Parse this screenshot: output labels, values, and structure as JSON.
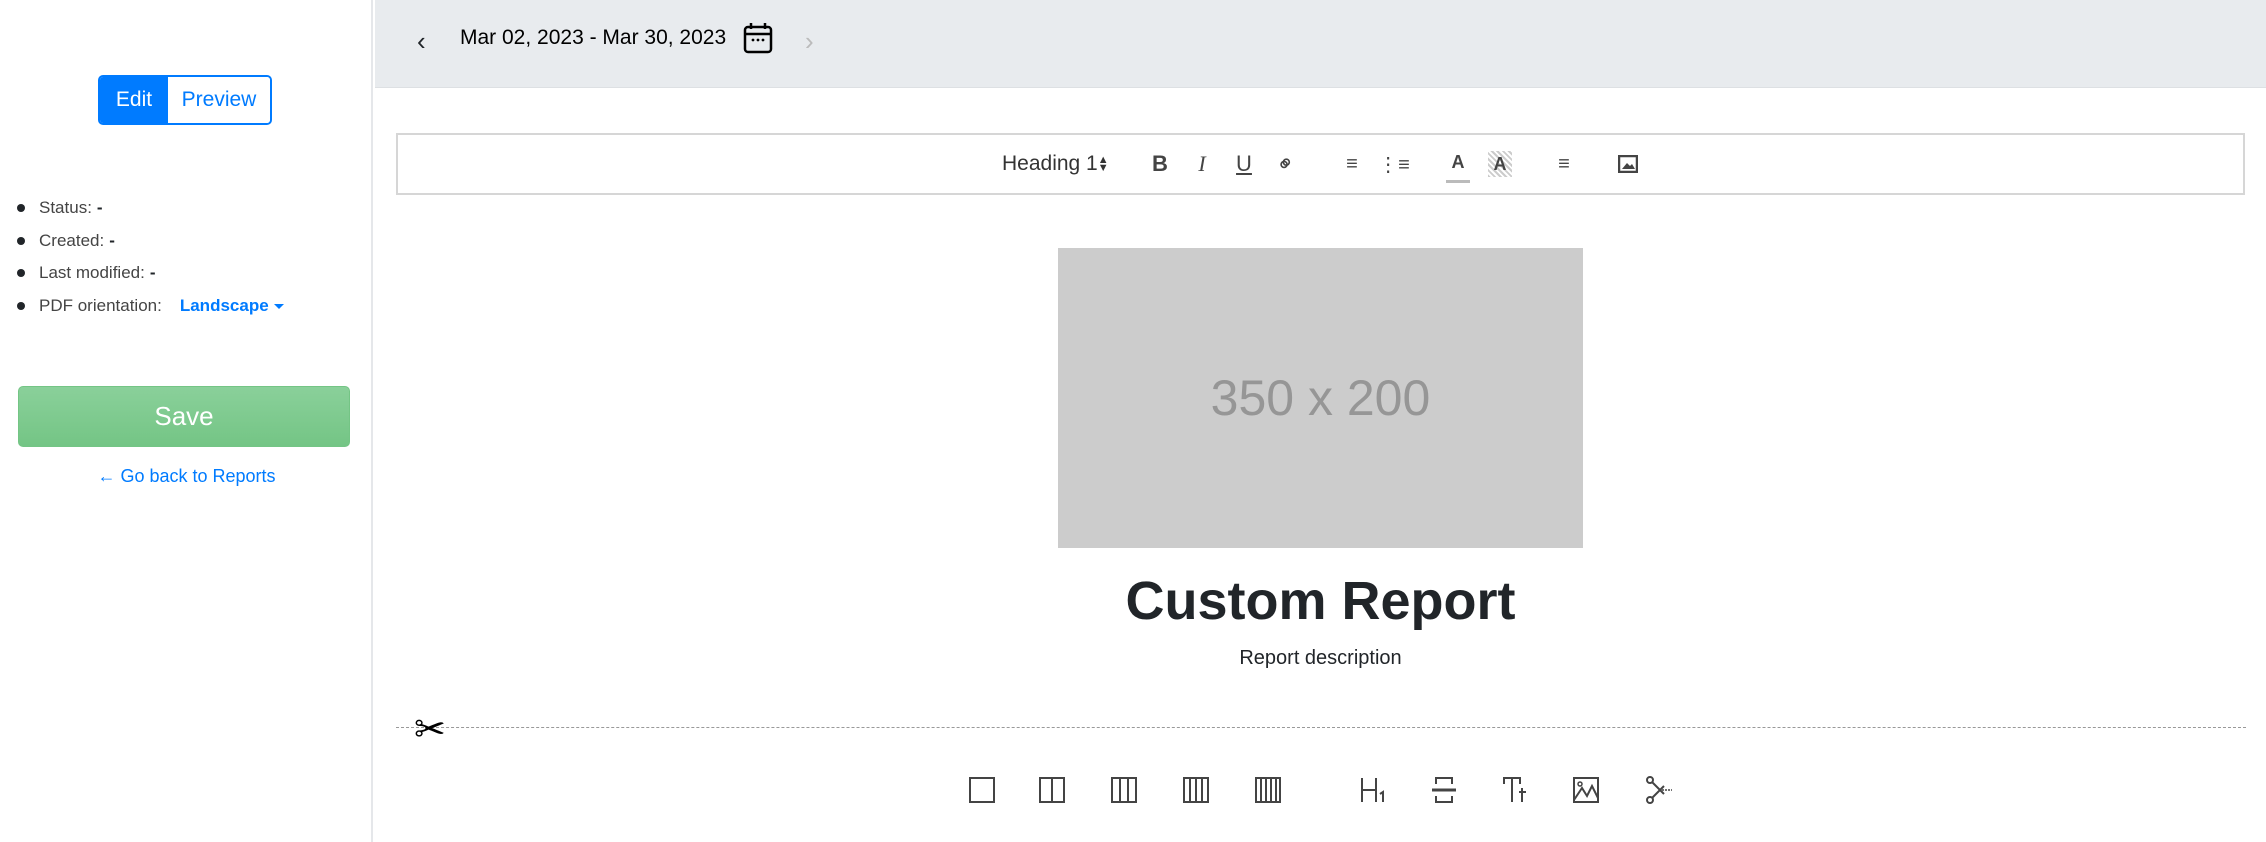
{
  "sidebar": {
    "mode_tabs": {
      "edit": "Edit",
      "preview": "Preview"
    },
    "info": [
      {
        "label": "Status:",
        "value": "-"
      },
      {
        "label": "Created:",
        "value": "-"
      },
      {
        "label": "Last modified:",
        "value": "-"
      }
    ],
    "pdf_orientation": {
      "label": "PDF orientation:",
      "value": "Landscape"
    },
    "save_label": "Save",
    "back_link": "Go back to Reports"
  },
  "header": {
    "date_range": "Mar 02, 2023 - Mar 30, 2023"
  },
  "toolbar": {
    "heading_select": "Heading 1"
  },
  "report": {
    "image_placeholder": "350 x 200",
    "title": "Custom Report",
    "description": "Report description"
  },
  "colors": {
    "primary": "#007bff",
    "save": "#7ac98a",
    "header_bg": "#e8ebee"
  }
}
